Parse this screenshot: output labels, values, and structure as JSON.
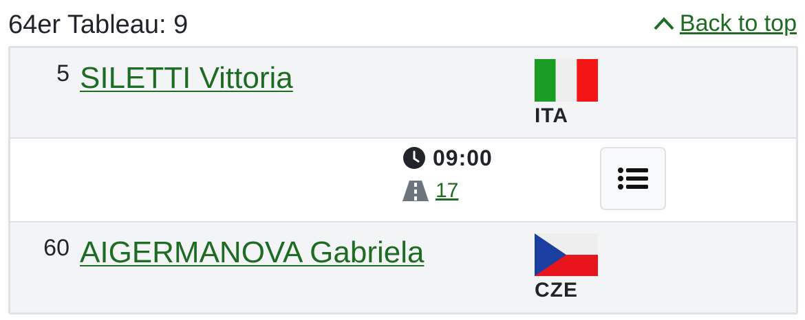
{
  "header": {
    "title": "64er Tableau: 9",
    "back_to_top": "Back to top"
  },
  "bout": {
    "fencer_a": {
      "seed": "5",
      "name": "SILETTI Vittoria",
      "nation": "ITA"
    },
    "info": {
      "time": "09:00",
      "piste": "17"
    },
    "fencer_b": {
      "seed": "60",
      "name": "AIGERMANOVA Gabriela",
      "nation": "CZE"
    }
  },
  "icons": {
    "back": "chevron-up-icon",
    "time": "clock-icon",
    "piste": "road-icon",
    "details": "list-icon"
  },
  "colors": {
    "link": "#1e6b23",
    "row_bg": "#f3f4f6",
    "border": "#dee2e6"
  }
}
